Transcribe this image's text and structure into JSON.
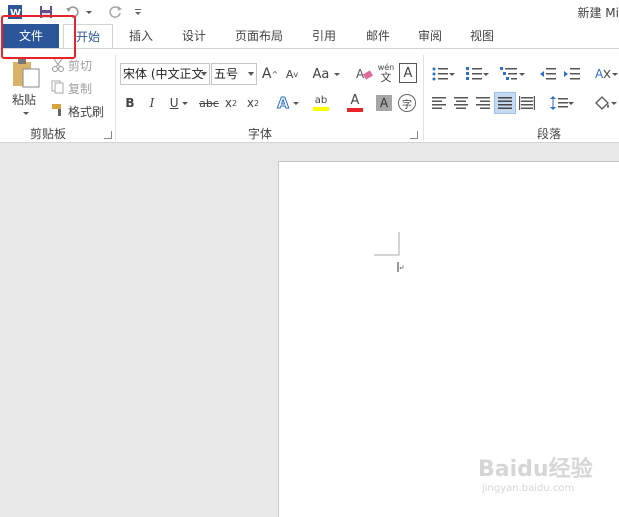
{
  "titlebar": {
    "title": "新建 Mi",
    "icons": [
      "word-app-icon",
      "save-icon",
      "undo-icon",
      "redo-icon",
      "customize-quick-access-icon"
    ]
  },
  "tabs": [
    {
      "label": "文件"
    },
    {
      "label": "开始"
    },
    {
      "label": "插入"
    },
    {
      "label": "设计"
    },
    {
      "label": "页面布局"
    },
    {
      "label": "引用"
    },
    {
      "label": "邮件"
    },
    {
      "label": "审阅"
    },
    {
      "label": "视图"
    }
  ],
  "clipboard": {
    "paste": "粘贴",
    "cut": "剪切",
    "copy": "复制",
    "format_painter": "格式刷",
    "group_label": "剪贴板"
  },
  "font": {
    "font_name": "宋体 (中文正文",
    "font_size": "五号",
    "grow": "A",
    "shrink": "A",
    "change_case": "Aa",
    "clear_label": "A",
    "phonetic": "wén",
    "phonetic_char": "文",
    "char_border": "A",
    "bold": "B",
    "italic": "I",
    "underline": "U",
    "strike": "abc",
    "subscript": "x",
    "subscript_mark": "2",
    "superscript": "x",
    "superscript_mark": "2",
    "text_effects": "A",
    "highlight": "ab",
    "font_color": "A",
    "char_shading": "A",
    "enclose": "字",
    "group_label": "字体"
  },
  "paragraph": {
    "group_label": "段落"
  },
  "watermark": {
    "brand": "Baidu经验",
    "url": "jingyan.baidu.com"
  },
  "colors": {
    "file_tab": "#2b579a",
    "highlight_box": "#e8242a",
    "doc_background": "#e8e8e8"
  }
}
